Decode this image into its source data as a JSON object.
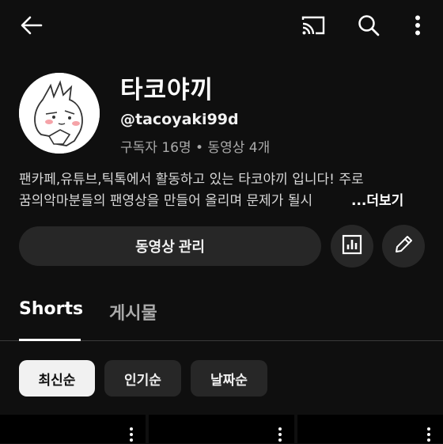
{
  "channel": {
    "name": "타코야끼",
    "handle": "@tacoyaki99d",
    "stats": "구독자 16명 • 동영상 4개",
    "description_line1": "팬카페,유튜브,틱톡에서 활동하고 있는 타코야끼 입니다! 주로",
    "description_line2": "꿈의악마분들의 팬영상을 만들어 올리며 문제가 될시",
    "more_label": "...더보기"
  },
  "actions": {
    "manage_label": "동영상 관리"
  },
  "tabs": [
    {
      "label": "Shorts",
      "active": true
    },
    {
      "label": "게시물",
      "active": false
    }
  ],
  "chips": [
    {
      "label": "최신순",
      "selected": true
    },
    {
      "label": "인기순",
      "selected": false
    },
    {
      "label": "날짜순",
      "selected": false
    }
  ],
  "icons": {
    "back": "back-arrow-icon",
    "cast": "cast-icon",
    "search": "search-icon",
    "more": "more-vert-icon",
    "analytics": "analytics-icon",
    "edit": "pencil-icon"
  },
  "colors": {
    "background": "#0f0f0f",
    "surface": "#272727",
    "text": "#f1f1f1",
    "muted": "#aaaaaa"
  }
}
